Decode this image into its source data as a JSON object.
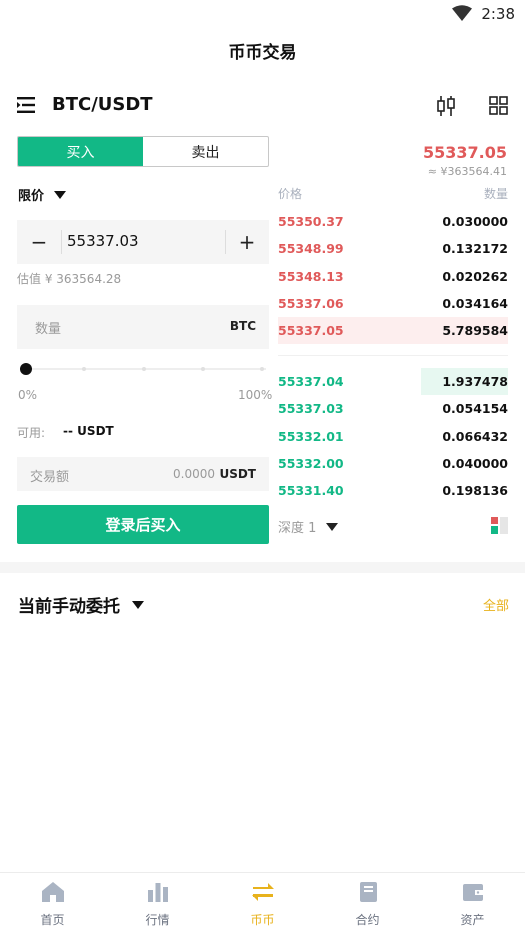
{
  "status_bar": {
    "time": "2:38"
  },
  "header": {
    "title": "币币交易"
  },
  "pair": {
    "name": "BTC/USDT"
  },
  "trade": {
    "tabs": [
      {
        "label": "买入",
        "active": true
      },
      {
        "label": "卖出",
        "active": false
      }
    ],
    "order_type": "限价",
    "price_value": "55337.03",
    "estimate": "估值 ¥ 363564.28",
    "quantity_placeholder": "数量",
    "quantity_unit": "BTC",
    "slider_min": "0%",
    "slider_max": "100%",
    "slider_value": 0,
    "available_label": "可用:",
    "available_value": "-- USDT",
    "amount_placeholder": "交易额",
    "amount_value": "0.0000",
    "amount_unit": "USDT",
    "buy_button": "登录后买入"
  },
  "orderbook": {
    "last_price": "55337.05",
    "last_price_cny": "≈ ¥363564.41",
    "price_header": "价格",
    "amount_header": "数量",
    "asks": [
      {
        "price": "55350.37",
        "amount": "0.030000",
        "depth": 0.0
      },
      {
        "price": "55348.99",
        "amount": "0.132172",
        "depth": 0.0
      },
      {
        "price": "55348.13",
        "amount": "0.020262",
        "depth": 0.0
      },
      {
        "price": "55337.06",
        "amount": "0.034164",
        "depth": 0.0
      },
      {
        "price": "55337.05",
        "amount": "5.789584",
        "depth": 1.0
      }
    ],
    "bids": [
      {
        "price": "55337.04",
        "amount": "1.937478",
        "depth": 0.38
      },
      {
        "price": "55337.03",
        "amount": "0.054154",
        "depth": 0.0
      },
      {
        "price": "55332.01",
        "amount": "0.066432",
        "depth": 0.0
      },
      {
        "price": "55332.00",
        "amount": "0.040000",
        "depth": 0.0
      },
      {
        "price": "55331.40",
        "amount": "0.198136",
        "depth": 0.0
      }
    ],
    "depth_label": "深度 1"
  },
  "orders": {
    "title": "当前手动委托",
    "all_label": "全部"
  },
  "bottom_nav": [
    {
      "label": "首页",
      "icon": "home-icon",
      "active": false
    },
    {
      "label": "行情",
      "icon": "market-chart-icon",
      "active": false
    },
    {
      "label": "币币",
      "icon": "exchange-arrows-icon",
      "active": true
    },
    {
      "label": "合约",
      "icon": "contract-book-icon",
      "active": false
    },
    {
      "label": "资产",
      "icon": "wallet-icon",
      "active": false
    }
  ],
  "colors": {
    "buy_green": "#12b886",
    "sell_red": "#e05a5a",
    "accent_gold": "#e8b21c"
  }
}
